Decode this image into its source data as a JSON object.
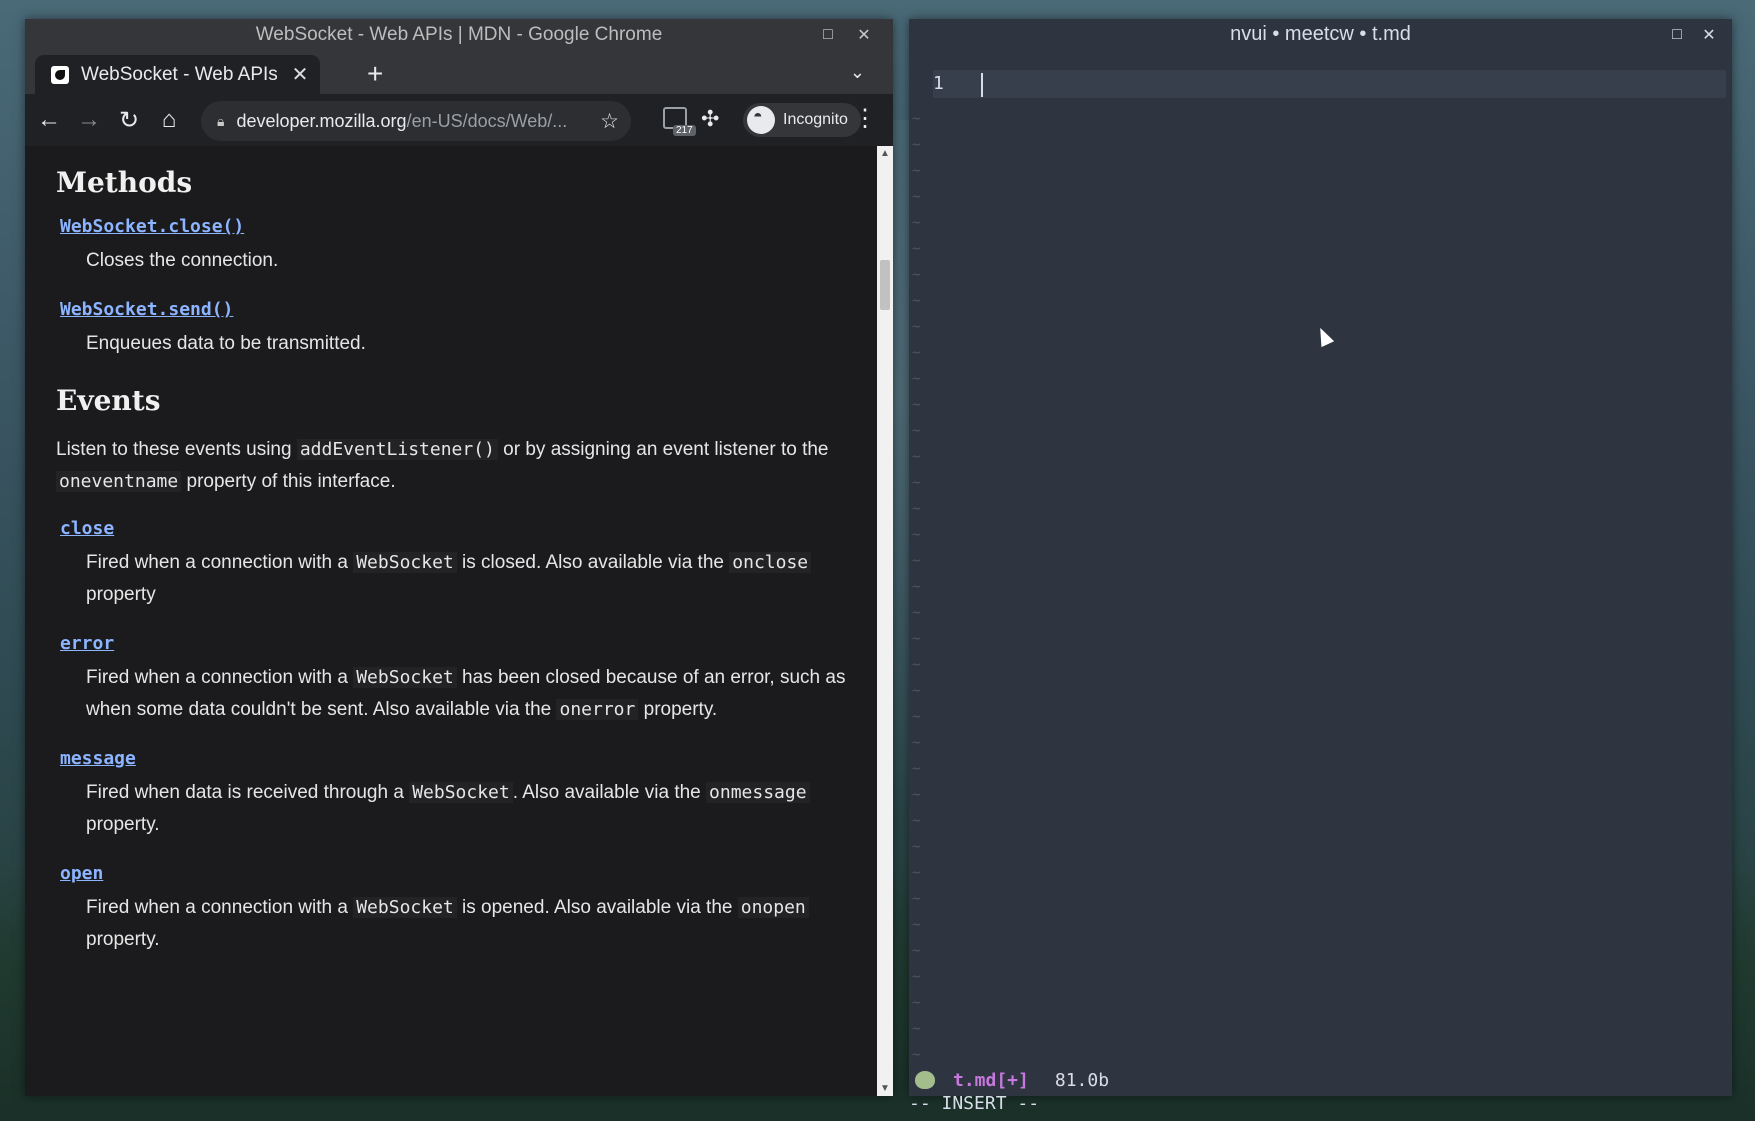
{
  "chrome": {
    "window_title": "WebSocket - Web APIs | MDN - Google Chrome",
    "tab_title": "WebSocket - Web APIs",
    "url_host": "developer.mozilla.org",
    "url_path": "/en-US/docs/Web/...",
    "ext_badge": "217",
    "incognito_label": "Incognito"
  },
  "doc": {
    "methods_heading": "Methods",
    "methods": [
      {
        "name": "WebSocket.close()",
        "desc": "Closes the connection."
      },
      {
        "name": "WebSocket.send()",
        "desc": "Enqueues data to be transmitted."
      }
    ],
    "events_heading": "Events",
    "events_intro": {
      "t1": "Listen to these events using ",
      "c1": "addEventListener()",
      "t2": " or by assigning an event listener to the ",
      "c2": "oneventname",
      "t3": " property of this interface."
    },
    "events": [
      {
        "name": "close",
        "t1": "Fired when a connection with a ",
        "c1": "WebSocket",
        "t2": " is closed. Also available via the ",
        "c2": "onclose",
        "t3": " property"
      },
      {
        "name": "error",
        "t1": "Fired when a connection with a ",
        "c1": "WebSocket",
        "t2": " has been closed because of an error, such as when some data couldn't be sent. Also available via the ",
        "c2": "onerror",
        "t3": " property."
      },
      {
        "name": "message",
        "t1": "Fired when data is received through a ",
        "c1": "WebSocket",
        "t2": ". Also available via the ",
        "c2": "onmessage",
        "t3": " property."
      },
      {
        "name": "open",
        "t1": "Fired when a connection with a ",
        "c1": "WebSocket",
        "t2": " is opened. Also available via the ",
        "c2": "onopen",
        "t3": " property."
      }
    ]
  },
  "nvui": {
    "window_title": "nvui • meetcw • t.md",
    "line_number": "1",
    "status_file": "t.md[+]",
    "status_size": "81.0b",
    "mode": "-- INSERT --"
  }
}
